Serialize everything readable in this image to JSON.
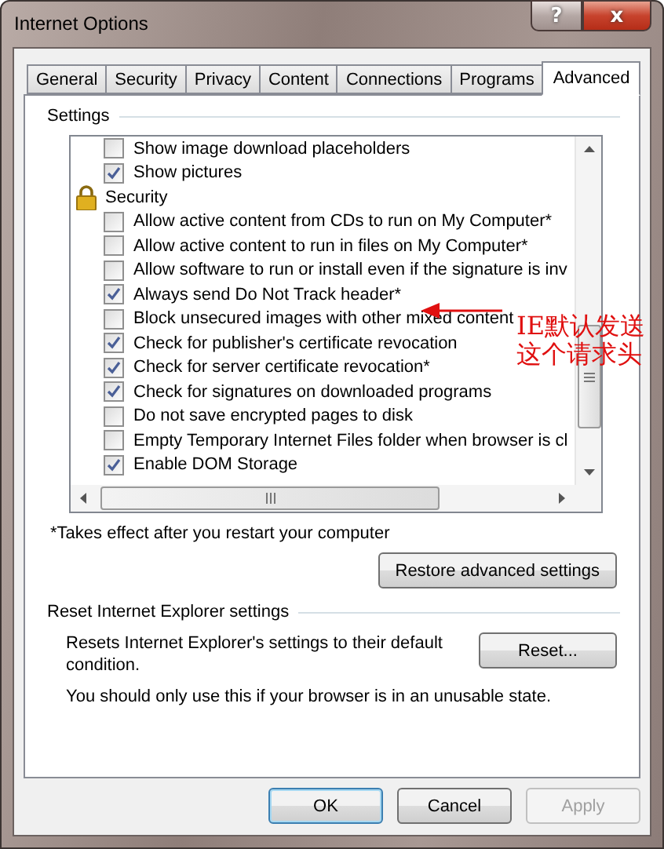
{
  "window": {
    "title": "Internet Options",
    "controls": [
      {
        "kind": "help",
        "label": "?"
      },
      {
        "kind": "close",
        "label": "x"
      }
    ]
  },
  "tabs": [
    {
      "label": "General",
      "selected": false
    },
    {
      "label": "Security",
      "selected": false
    },
    {
      "label": "Privacy",
      "selected": false
    },
    {
      "label": "Content",
      "selected": false
    },
    {
      "label": "Connections",
      "selected": false
    },
    {
      "label": "Programs",
      "selected": false
    },
    {
      "label": "Advanced",
      "selected": true
    }
  ],
  "settings": {
    "title": "Settings",
    "items": [
      {
        "kind": "checkbox",
        "label": "Show image download placeholders",
        "checked": false
      },
      {
        "kind": "checkbox",
        "label": "Show pictures",
        "checked": true
      },
      {
        "kind": "category",
        "label": "Security"
      },
      {
        "kind": "checkbox",
        "label": "Allow active content from CDs to run on My Computer*",
        "checked": false
      },
      {
        "kind": "checkbox",
        "label": "Allow active content to run in files on My Computer*",
        "checked": false
      },
      {
        "kind": "checkbox",
        "label": "Allow software to run or install even if the signature is inv",
        "checked": false
      },
      {
        "kind": "checkbox",
        "label": "Always send Do Not Track header*",
        "checked": true
      },
      {
        "kind": "checkbox",
        "label": "Block unsecured images with other mixed content",
        "checked": false
      },
      {
        "kind": "checkbox",
        "label": "Check for publisher's certificate revocation",
        "checked": true
      },
      {
        "kind": "checkbox",
        "label": "Check for server certificate revocation*",
        "checked": true
      },
      {
        "kind": "checkbox",
        "label": "Check for signatures on downloaded programs",
        "checked": true
      },
      {
        "kind": "checkbox",
        "label": "Do not save encrypted pages to disk",
        "checked": false
      },
      {
        "kind": "checkbox",
        "label": "Empty Temporary Internet Files folder when browser is cl",
        "checked": false
      },
      {
        "kind": "checkbox",
        "label": "Enable DOM Storage",
        "checked": true
      }
    ],
    "footnote": "*Takes effect after you restart your computer",
    "restore_button": "Restore advanced settings"
  },
  "reset": {
    "title": "Reset Internet Explorer settings",
    "description": "Resets Internet Explorer's settings to their default condition.",
    "button": "Reset...",
    "warning": "You should only use this if your browser is in an unusable state."
  },
  "annotation": {
    "lines": [
      "IE默认发送",
      "这个请求头"
    ]
  },
  "buttons": [
    {
      "label": "OK",
      "default": true,
      "disabled": false
    },
    {
      "label": "Cancel",
      "default": false,
      "disabled": false
    },
    {
      "label": "Apply",
      "default": false,
      "disabled": true
    }
  ]
}
